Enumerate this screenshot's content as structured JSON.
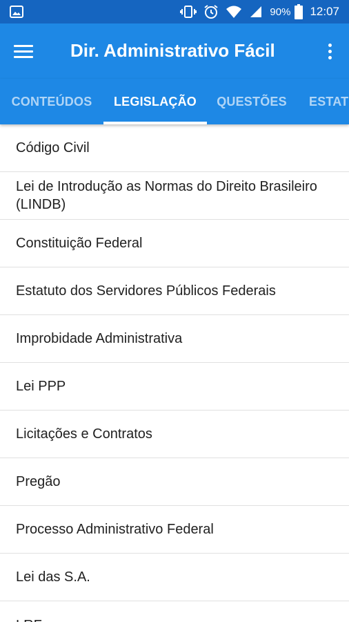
{
  "status_bar": {
    "battery_percent": "90%",
    "time": "12:07",
    "icons": [
      "image-icon",
      "vibrate-icon",
      "alarm-icon",
      "wifi-icon",
      "signal-icon",
      "battery-icon"
    ]
  },
  "app_bar": {
    "title": "Dir. Administrativo Fácil",
    "menu_icon": "hamburger-menu-icon",
    "more_icon": "more-vert-icon"
  },
  "tabs": [
    {
      "label": "CONTEÚDOS",
      "active": false
    },
    {
      "label": "LEGISLAÇÃO",
      "active": true
    },
    {
      "label": "QUESTÕES",
      "active": false
    },
    {
      "label": "ESTAT",
      "active": false
    }
  ],
  "list": {
    "items": [
      "Código Civil",
      "Lei de Introdução as Normas do Direito Brasileiro (LINDB)",
      "Constituição Federal",
      "Estatuto dos Servidores Públicos Federais",
      "Improbidade Administrativa",
      "Lei PPP",
      "Licitações e Contratos",
      "Pregão",
      "Processo Administrativo Federal",
      "Lei das S.A.",
      "LRF"
    ]
  },
  "colors": {
    "status_bar": "#1565C0",
    "primary": "#1E88E5",
    "text": "#212121",
    "divider": "#e0e0e0"
  }
}
